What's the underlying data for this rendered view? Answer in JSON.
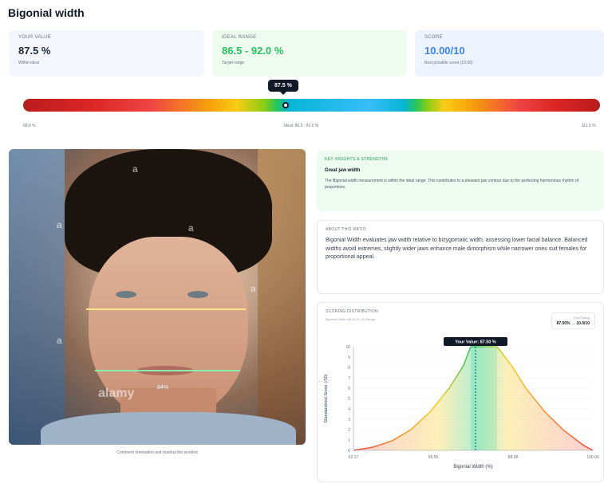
{
  "page": {
    "title": "Bigonial width"
  },
  "stats": [
    {
      "label": "YOUR VALUE",
      "value": "87.5 %",
      "sub": "Within ideal"
    },
    {
      "label": "IDEAL RANGE",
      "value": "86.5 - 92.0 %",
      "sub": "Target range"
    },
    {
      "label": "SCORE",
      "value": "10.00/10",
      "sub": "Best possible score (10.00)"
    }
  ],
  "slider": {
    "tooltip": "87.5 %",
    "left_tick": "68.0 %",
    "center_tick": "Ideal: 86.5 - 92.0 %",
    "right_tick": "111.0 %",
    "position_fraction": 0.46
  },
  "photo": {
    "caption": "Comment orientation and readout the position",
    "measure_label": "84%",
    "watermarks": [
      "a",
      "a",
      "a",
      "a",
      "a",
      "alamy"
    ]
  },
  "insight": {
    "heading": "KEY INSIGHTS & STRENGTHS",
    "title": "Great jaw width",
    "body": "The Bigonial width measurement is within the ideal range. This contributes to a pleasant jaw contour due to the perfecting harmonious rhythm of proportions."
  },
  "about": {
    "heading": "ABOUT THIS RATIO",
    "body": "Bigonial Width evaluates jaw width relative to bizygomatic width, assessing lower facial balance. Balanced widths avoid extremes, slightly wider jaws enhance male dimorphism while narrower ones suit females for proportional appeal."
  },
  "distribution": {
    "heading": "SCORING DISTRIBUTION",
    "sub": "Bigonial Width: 86.50-92.00 Range",
    "score_label": "Your Rating",
    "score_value": "87.50% → 10.0/10",
    "your_value_label": "Your Value: 87.50 %"
  },
  "chart_data": {
    "type": "area",
    "title": "",
    "xlabel": "Bigonial Width (%)",
    "ylabel": "Standardized Score (/10)",
    "x_ticks": [
      "62.17",
      "66.55",
      "88.08",
      "100.00"
    ],
    "y_ticks": [
      "0",
      "1",
      "2",
      "3",
      "4",
      "5",
      "6",
      "7",
      "8",
      "9",
      "10"
    ],
    "xlim": [
      62.0,
      112.0
    ],
    "ylim": [
      0,
      10
    ],
    "ideal_range": [
      86.5,
      92.0
    ],
    "your_value": 87.5,
    "curve": [
      {
        "x": 62.0,
        "y": 0.0
      },
      {
        "x": 66.0,
        "y": 0.3
      },
      {
        "x": 70.0,
        "y": 0.9
      },
      {
        "x": 74.0,
        "y": 2.0
      },
      {
        "x": 78.0,
        "y": 3.7
      },
      {
        "x": 82.0,
        "y": 6.0
      },
      {
        "x": 85.0,
        "y": 8.2
      },
      {
        "x": 86.5,
        "y": 10.0
      },
      {
        "x": 92.0,
        "y": 10.0
      },
      {
        "x": 95.0,
        "y": 8.2
      },
      {
        "x": 98.0,
        "y": 6.0
      },
      {
        "x": 102.0,
        "y": 3.7
      },
      {
        "x": 106.0,
        "y": 1.9
      },
      {
        "x": 110.0,
        "y": 0.5
      },
      {
        "x": 112.0,
        "y": 0.0
      }
    ],
    "colors": {
      "curve_left": "#ef4444",
      "curve_mid": "#22c55e",
      "ideal_fill": "#5eead4"
    }
  }
}
